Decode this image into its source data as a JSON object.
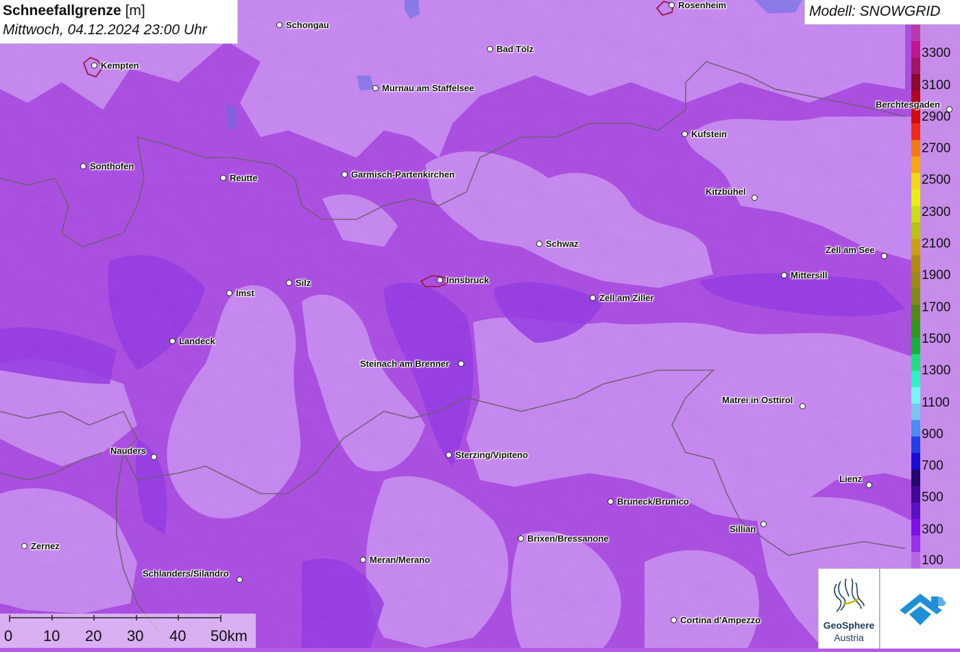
{
  "header": {
    "title": "Schneefallgrenze",
    "unit": "[m]",
    "datetime": "Mittwoch, 04.12.2024 23:00 Uhr",
    "model": "Modell: SNOWGRID"
  },
  "legend": {
    "labels": [
      "3300",
      "3100",
      "2900",
      "2700",
      "2500",
      "2300",
      "2100",
      "1900",
      "1700",
      "1500",
      "1300",
      "1100",
      "900",
      "700",
      "500",
      "300",
      "100"
    ],
    "colors": [
      "#b83aa8",
      "#c0178a",
      "#a51460",
      "#8c0a2a",
      "#b0051a",
      "#d40a0a",
      "#f02a14",
      "#f57a10",
      "#f7a80c",
      "#f5d80e",
      "#e9f00e",
      "#c9e00c",
      "#b8c40a",
      "#c8a20c",
      "#b08c0a",
      "#9c8c10",
      "#7f8c12",
      "#4f8c10",
      "#2c9a18",
      "#14b23a",
      "#1ce07a",
      "#2ef2c0",
      "#74f7f0",
      "#7ac4f0",
      "#4a8cf0",
      "#2040e8",
      "#1a0cd8",
      "#20086c",
      "#3c0a94",
      "#5c10c4",
      "#8010e8",
      "#9a30e8",
      "#b565e8"
    ],
    "accent_map_color": "#b35ce8"
  },
  "scale": {
    "ticks": [
      "0",
      "10",
      "20",
      "30",
      "40",
      "50km"
    ]
  },
  "cities": [
    {
      "name": "Rosenheim"
    },
    {
      "name": "Schongau"
    },
    {
      "name": "Kempten"
    },
    {
      "name": "Bad Tölz"
    },
    {
      "name": "Murnau am Staffelsee"
    },
    {
      "name": "Berchtesgaden"
    },
    {
      "name": "Kufstein"
    },
    {
      "name": "Sonthofen"
    },
    {
      "name": "Reutte"
    },
    {
      "name": "Garmisch-Partenkirchen"
    },
    {
      "name": "Kitzbühel"
    },
    {
      "name": "Schwaz"
    },
    {
      "name": "Zell am See"
    },
    {
      "name": "Mittersill"
    },
    {
      "name": "Innsbruck"
    },
    {
      "name": "Imst"
    },
    {
      "name": "Silz"
    },
    {
      "name": "Zell am Ziller"
    },
    {
      "name": "Landeck"
    },
    {
      "name": "Steinach am Brenner"
    },
    {
      "name": "Matrei in Osttirol"
    },
    {
      "name": "Nauders"
    },
    {
      "name": "Sterzing/Vipiteno"
    },
    {
      "name": "Lienz"
    },
    {
      "name": "Bruneck/Brunico"
    },
    {
      "name": "Sillian"
    },
    {
      "name": "Brixen/Bressanone"
    },
    {
      "name": "Zernez"
    },
    {
      "name": "Meran/Merano"
    },
    {
      "name": "Schlanders/Silandro"
    },
    {
      "name": "Cortina d'Ampezzo"
    }
  ],
  "logos": {
    "geosphere_name": "GeoSphere",
    "geosphere_sub": "Austria"
  }
}
